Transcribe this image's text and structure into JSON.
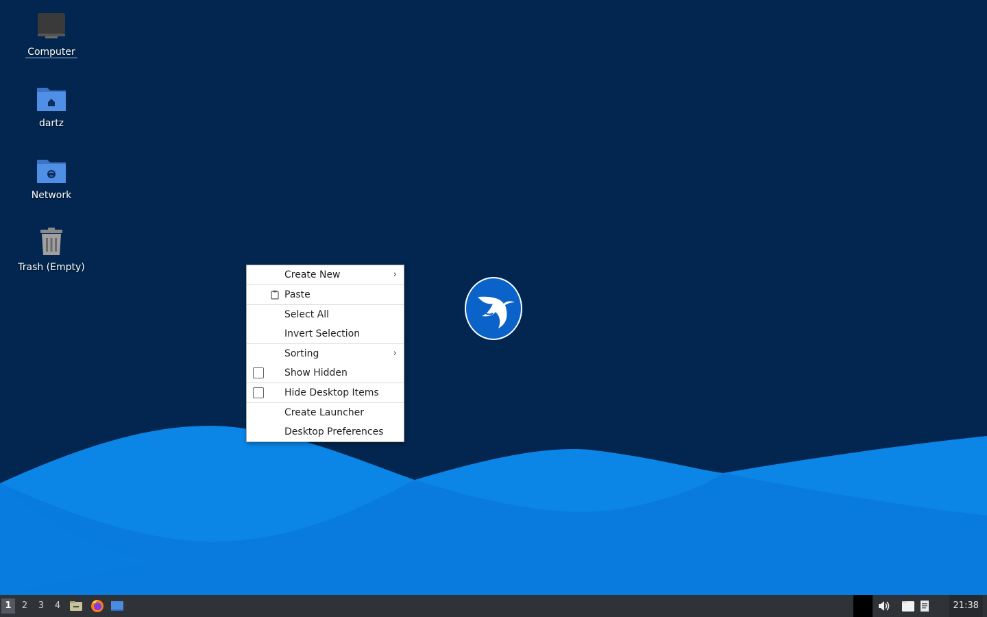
{
  "desktop": {
    "background_color": "#02264f",
    "icons": [
      {
        "label": "Computer",
        "icon": "computer-icon"
      },
      {
        "label": "dartz",
        "icon": "home-folder-icon"
      },
      {
        "label": "Network",
        "icon": "network-folder-icon"
      },
      {
        "label": "Trash (Empty)",
        "icon": "trash-icon"
      }
    ],
    "logo": "hummingbird-logo-icon"
  },
  "context_menu": {
    "items": [
      {
        "label": "Create New",
        "submenu": true
      },
      {
        "label": "Paste",
        "icon": "paste-icon"
      },
      {
        "label": "Select All"
      },
      {
        "label": "Invert Selection"
      },
      {
        "label": "Sorting",
        "submenu": true
      },
      {
        "label": "Show Hidden",
        "checkbox": true,
        "checked": false
      },
      {
        "label": "Hide Desktop Items",
        "checkbox": true,
        "checked": false
      },
      {
        "label": "Create Launcher"
      },
      {
        "label": "Desktop Preferences"
      }
    ],
    "submenu_arrow": "›"
  },
  "taskbar": {
    "workspaces": [
      "1",
      "2",
      "3",
      "4"
    ],
    "active_workspace": "1",
    "launchers": [
      "file-manager-icon",
      "firefox-icon",
      "show-desktop-icon"
    ],
    "tray": [
      "volume-icon",
      "clipboard-icon",
      "notes-icon"
    ],
    "clock": "21:38",
    "accent": "#2f3237"
  }
}
